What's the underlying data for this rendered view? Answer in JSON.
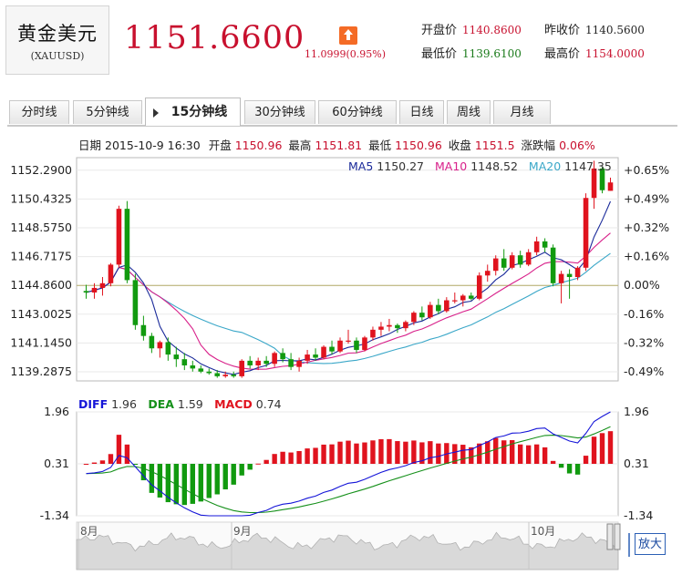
{
  "header": {
    "name": "黄金美元",
    "code": "(XAUUSD)",
    "price": "1151.6600",
    "change": "11.0999(0.95%)",
    "stats": [
      {
        "key": "open",
        "label": "开盘价",
        "value": "1140.8600",
        "color": "red"
      },
      {
        "key": "prev_close",
        "label": "昨收价",
        "value": "1140.5600",
        "color": "dark"
      },
      {
        "key": "low",
        "label": "最低价",
        "value": "1139.6100",
        "color": "green"
      },
      {
        "key": "high",
        "label": "最高价",
        "value": "1154.0000",
        "color": "red"
      }
    ]
  },
  "tabs": [
    "分时线",
    "5分钟线",
    "15分钟线",
    "30分钟线",
    "60分钟线",
    "日线",
    "周线",
    "月线"
  ],
  "active_tab": "15分钟线",
  "info_line": {
    "date_label": "日期",
    "date": "2015-10-9 16:30",
    "open_label": "开盘",
    "open": "1150.96",
    "high_label": "最高",
    "high": "1151.81",
    "low_label": "最低",
    "low": "1150.96",
    "close_label": "收盘",
    "close": "1151.5",
    "pct_label": "涨跌幅",
    "pct": "0.06%"
  },
  "zoom_label": "放大",
  "colors": {
    "up": "#e0131e",
    "down": "#119a0f",
    "ma5": "#1a2a9a",
    "ma10": "#d8208a",
    "ma20": "#3aa7c8",
    "diff": "#1515d8",
    "dea": "#15901a",
    "macd": "#e0131e"
  },
  "chart_data": [
    {
      "type": "candlestick",
      "name": "main",
      "y_ticks": [
        "1152.2900",
        "1150.4325",
        "1148.5750",
        "1146.7175",
        "1144.8600",
        "1143.0025",
        "1141.1450",
        "1139.2875"
      ],
      "pct_ticks": [
        "+0.65%",
        "+0.49%",
        "+0.32%",
        "+0.16%",
        "0.00%",
        "-0.16%",
        "-0.32%",
        "-0.49%"
      ],
      "ylim": [
        1138.7,
        1153.1
      ],
      "baseline": 1144.86,
      "ma_legend": [
        {
          "name": "MA5",
          "value": "1150.27"
        },
        {
          "name": "MA10",
          "value": "1148.52"
        },
        {
          "name": "MA20",
          "value": "1147.35"
        }
      ],
      "ohlc": [
        [
          1144.5,
          1144.9,
          1144.0,
          1144.4
        ],
        [
          1144.4,
          1145.0,
          1144.0,
          1144.7
        ],
        [
          1144.7,
          1145.4,
          1144.2,
          1145.0
        ],
        [
          1145.0,
          1146.3,
          1144.8,
          1146.2
        ],
        [
          1146.2,
          1150.0,
          1146.0,
          1149.8
        ],
        [
          1149.8,
          1150.3,
          1145.0,
          1145.2
        ],
        [
          1145.2,
          1145.6,
          1142.0,
          1142.3
        ],
        [
          1142.3,
          1142.9,
          1141.3,
          1141.6
        ],
        [
          1141.6,
          1141.8,
          1140.5,
          1140.8
        ],
        [
          1140.8,
          1141.3,
          1140.2,
          1141.2
        ],
        [
          1141.2,
          1141.5,
          1140.0,
          1140.4
        ],
        [
          1140.4,
          1140.9,
          1139.6,
          1140.1
        ],
        [
          1140.1,
          1140.5,
          1139.4,
          1139.7
        ],
        [
          1139.7,
          1140.0,
          1139.3,
          1139.5
        ],
        [
          1139.5,
          1139.7,
          1139.2,
          1139.3
        ],
        [
          1139.3,
          1139.5,
          1139.1,
          1139.2
        ],
        [
          1139.2,
          1139.4,
          1138.9,
          1139.0
        ],
        [
          1139.0,
          1139.3,
          1138.9,
          1139.1
        ],
        [
          1139.1,
          1139.3,
          1138.9,
          1139.0
        ],
        [
          1139.0,
          1140.1,
          1138.9,
          1140.0
        ],
        [
          1140.0,
          1140.3,
          1139.5,
          1139.7
        ],
        [
          1139.7,
          1140.2,
          1139.4,
          1140.0
        ],
        [
          1140.0,
          1140.3,
          1139.6,
          1139.8
        ],
        [
          1139.8,
          1140.6,
          1139.6,
          1140.5
        ],
        [
          1140.5,
          1140.8,
          1139.9,
          1140.1
        ],
        [
          1140.1,
          1140.5,
          1139.4,
          1139.6
        ],
        [
          1139.6,
          1140.2,
          1139.3,
          1140.0
        ],
        [
          1140.0,
          1140.7,
          1139.8,
          1140.4
        ],
        [
          1140.4,
          1140.8,
          1140.0,
          1140.2
        ],
        [
          1140.2,
          1141.0,
          1140.1,
          1140.9
        ],
        [
          1140.9,
          1141.3,
          1140.4,
          1140.6
        ],
        [
          1140.6,
          1141.5,
          1140.5,
          1141.3
        ],
        [
          1141.3,
          1142.0,
          1141.1,
          1141.3
        ],
        [
          1141.3,
          1141.5,
          1140.5,
          1140.7
        ],
        [
          1140.7,
          1141.6,
          1140.6,
          1141.5
        ],
        [
          1141.5,
          1142.2,
          1141.3,
          1142.0
        ],
        [
          1142.0,
          1142.5,
          1141.6,
          1142.2
        ],
        [
          1142.2,
          1142.7,
          1141.9,
          1142.3
        ],
        [
          1142.3,
          1142.4,
          1141.8,
          1142.1
        ],
        [
          1142.1,
          1142.6,
          1141.9,
          1142.5
        ],
        [
          1142.5,
          1143.2,
          1142.3,
          1143.1
        ],
        [
          1143.1,
          1143.5,
          1142.6,
          1142.8
        ],
        [
          1142.8,
          1143.8,
          1142.7,
          1143.6
        ],
        [
          1143.6,
          1144.0,
          1143.0,
          1143.2
        ],
        [
          1143.2,
          1144.1,
          1143.1,
          1143.9
        ],
        [
          1143.9,
          1144.4,
          1143.7,
          1143.9
        ],
        [
          1143.9,
          1144.3,
          1143.5,
          1144.2
        ],
        [
          1144.2,
          1144.4,
          1143.9,
          1144.0
        ],
        [
          1144.0,
          1145.7,
          1143.9,
          1145.5
        ],
        [
          1145.5,
          1146.2,
          1145.1,
          1145.8
        ],
        [
          1145.8,
          1146.8,
          1145.5,
          1146.6
        ],
        [
          1146.6,
          1147.2,
          1145.8,
          1146.0
        ],
        [
          1146.0,
          1147.0,
          1145.9,
          1146.8
        ],
        [
          1146.8,
          1147.1,
          1146.0,
          1146.2
        ],
        [
          1146.2,
          1147.2,
          1146.1,
          1147.0
        ],
        [
          1147.0,
          1148.0,
          1146.8,
          1147.7
        ],
        [
          1147.7,
          1147.9,
          1147.0,
          1147.3
        ],
        [
          1147.3,
          1147.5,
          1144.8,
          1145.0
        ],
        [
          1145.0,
          1145.8,
          1143.7,
          1145.6
        ],
        [
          1145.6,
          1145.9,
          1144.0,
          1145.4
        ],
        [
          1145.4,
          1146.1,
          1145.2,
          1146.0
        ],
        [
          1146.0,
          1150.8,
          1145.8,
          1150.5
        ],
        [
          1150.5,
          1152.9,
          1149.8,
          1152.4
        ],
        [
          1152.4,
          1152.5,
          1150.8,
          1151.0
        ],
        [
          1150.96,
          1151.81,
          1150.96,
          1151.5
        ]
      ]
    },
    {
      "type": "macd",
      "name": "macd",
      "y_ticks": [
        "1.96",
        "0.31",
        "-1.34"
      ],
      "ylim": [
        -1.34,
        1.96
      ],
      "legend": [
        {
          "name": "DIFF",
          "value": "1.96"
        },
        {
          "name": "DEA",
          "value": "1.59"
        },
        {
          "name": "MACD",
          "value": "0.74"
        }
      ]
    },
    {
      "type": "area",
      "name": "overview",
      "x_labels": [
        "8月",
        "9月",
        "10月"
      ]
    }
  ]
}
